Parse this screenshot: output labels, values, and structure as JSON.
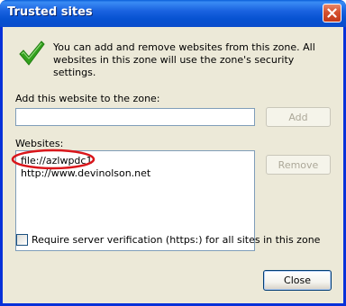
{
  "window": {
    "title": "Trusted sites"
  },
  "icons": {
    "close": "close-icon",
    "check": "green-check-icon"
  },
  "info": {
    "text": "You can add and remove websites from this zone. All websites in this zone will use the zone's security settings."
  },
  "add_site": {
    "label": "Add this website to the zone:",
    "value": "",
    "button_label": "Add",
    "button_enabled": false
  },
  "websites": {
    "label": "Websites:",
    "items": [
      "file://azlwpdc1",
      "http://www.devinolson.net"
    ],
    "remove_label": "Remove",
    "remove_enabled": false,
    "highlighted_item": "file://azlwpdc1"
  },
  "require_https": {
    "label": "Require server verification (https:) for all sites in this zone",
    "checked": false
  },
  "footer": {
    "close_label": "Close"
  },
  "colors": {
    "titlebar": "#0a4ccc",
    "dialog_face": "#ece9d8",
    "annotation_circle": "#d9161b",
    "check_green": "#33a11d"
  }
}
